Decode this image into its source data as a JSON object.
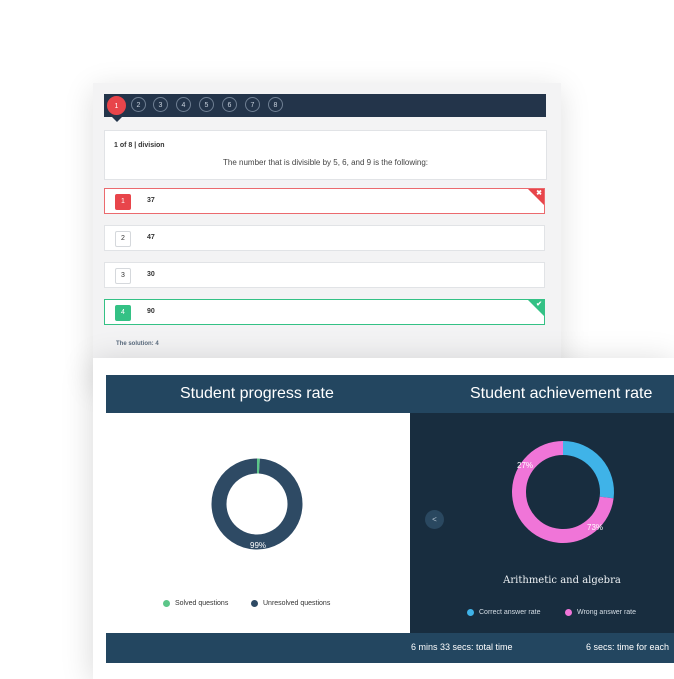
{
  "quiz": {
    "question_numbers": [
      "1",
      "2",
      "3",
      "4",
      "5",
      "6",
      "7",
      "8"
    ],
    "active_question": 1,
    "meta": "1 of 8 | division",
    "question": "The number that is divisible by 5, 6, and 9 is the following:",
    "options": [
      {
        "number": "1",
        "value": "37",
        "state": "wrong"
      },
      {
        "number": "2",
        "value": "47",
        "state": "neutral"
      },
      {
        "number": "3",
        "value": "30",
        "state": "neutral"
      },
      {
        "number": "4",
        "value": "90",
        "state": "correct"
      }
    ],
    "wrong_mark": "✖",
    "correct_mark": "✔",
    "solution": "The solution: 4"
  },
  "results": {
    "progress_title": "Student progress rate",
    "achievement_title": "Student achievement rate",
    "prev_label": "<",
    "footer_total": "6 mins 33 secs: total time",
    "footer_each": "6 secs: time for each"
  },
  "chart_data": [
    {
      "type": "pie",
      "title": "Student progress rate",
      "labels": [
        "Solved questions",
        "Unresolved questions"
      ],
      "values": [
        1,
        99
      ],
      "data_labels": [
        "",
        "99%"
      ],
      "colors": [
        "#5cc689",
        "#2e4a64"
      ],
      "legend": "bottom"
    },
    {
      "type": "pie",
      "title": "Student achievement rate",
      "subtitle": "Arithmetic and algebra",
      "labels": [
        "Correct answer rate",
        "Wrong answer rate"
      ],
      "values": [
        27,
        73
      ],
      "data_labels": [
        "27%",
        "73%"
      ],
      "colors": [
        "#3fb3e8",
        "#f075d8"
      ],
      "legend": "bottom"
    }
  ]
}
